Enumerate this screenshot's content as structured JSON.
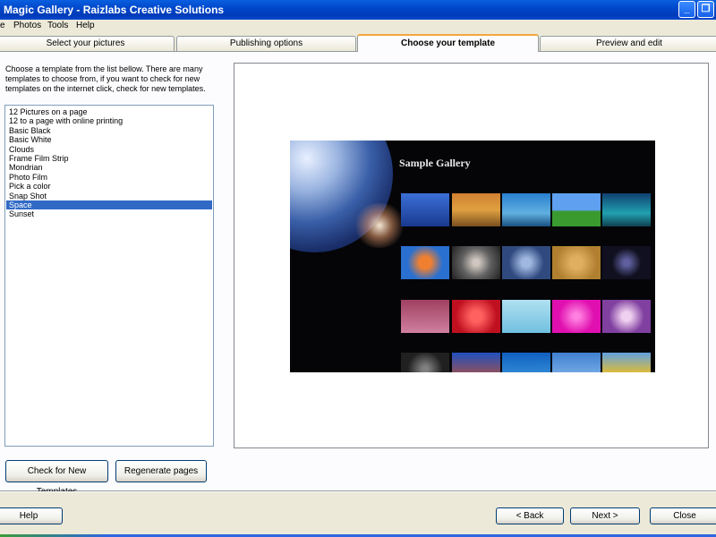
{
  "window": {
    "title": "Magic Gallery - Raizlabs Creative Solutions"
  },
  "menu": [
    "e",
    "Photos",
    "Tools",
    "Help"
  ],
  "tabs": [
    {
      "label": "Select your pictures",
      "active": false
    },
    {
      "label": "Publishing options",
      "active": false
    },
    {
      "label": "Choose your template",
      "active": true
    },
    {
      "label": "Preview and edit",
      "active": false
    }
  ],
  "instructions": "Choose a template from the list bellow.  There are many templates to choose from, if you want to check for new templates on the internet click, check for new templates.",
  "templates": {
    "items": [
      "12  Pictures on a page",
      "12 to a page with online printing",
      "Basic Black",
      "Basic White",
      "Clouds",
      "Frame Film Strip",
      "Mondrian",
      "Photo Film",
      "Pick a color",
      "Snap Shot",
      "Space",
      "Sunset"
    ],
    "selected": "Space"
  },
  "buttons": {
    "check_templates": "Check for New Templates",
    "regenerate": "Regenerate pages",
    "help": "Help",
    "back": "< Back",
    "next": "Next >",
    "close": "Close"
  },
  "preview": {
    "gallery_title": "Sample Gallery"
  },
  "colors": {
    "selection": "#316ac5",
    "active_tab_accent": "#f1a83e",
    "titlebar": "#0045c8",
    "gallery_background": "#050508"
  }
}
